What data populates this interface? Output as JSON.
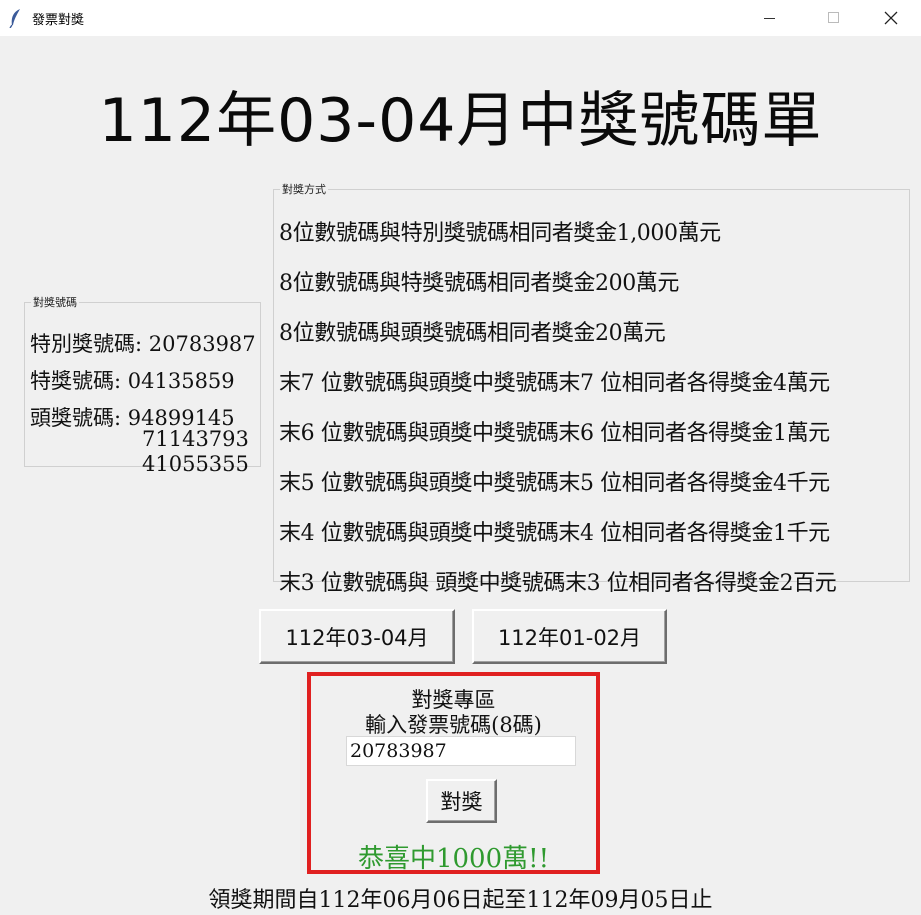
{
  "window": {
    "title": "發票對獎"
  },
  "main_title": "112年03-04月中獎號碼單",
  "numbers_group": {
    "legend": "對獎號碼",
    "special_label": "特別獎號碼:",
    "special": "20783987",
    "grand_label": "特獎號碼:",
    "grand": "04135859",
    "first_label": "頭獎號碼:",
    "first": [
      "94899145",
      "71143793",
      "41055355"
    ]
  },
  "rules_group": {
    "legend": "對獎方式",
    "rules": [
      "8位數號碼與特別獎號碼相同者獎金1,000萬元",
      "8位數號碼與特獎號碼相同者獎金200萬元",
      "8位數號碼與頭獎號碼相同者獎金20萬元",
      "末7 位數號碼與頭獎中獎號碼末7 位相同者各得獎金4萬元",
      "末6 位數號碼與頭獎中獎號碼末6 位相同者各得獎金1萬元",
      "末5 位數號碼與頭獎中獎號碼末5 位相同者各得獎金4千元",
      "末4 位數號碼與頭獎中獎號碼末4 位相同者各得獎金1千元",
      "末3 位數號碼與 頭獎中獎號碼末3 位相同者各得獎金2百元"
    ]
  },
  "period_buttons": [
    "112年03-04月",
    "112年01-02月"
  ],
  "check_area": {
    "title": "對獎專區",
    "prompt": "輸入發票號碼(8碼)",
    "input_value": "20783987",
    "button": "對獎",
    "result": "恭喜中1000萬!!"
  },
  "claim_period": "領獎期間自112年06月06日起至112年09月05日止",
  "colors": {
    "highlight_border": "#e02020",
    "result_text": "#2f9a2f"
  },
  "icons": {
    "app": "feather-icon",
    "minimize": "minimize-icon",
    "maximize": "maximize-icon",
    "close": "close-icon"
  }
}
